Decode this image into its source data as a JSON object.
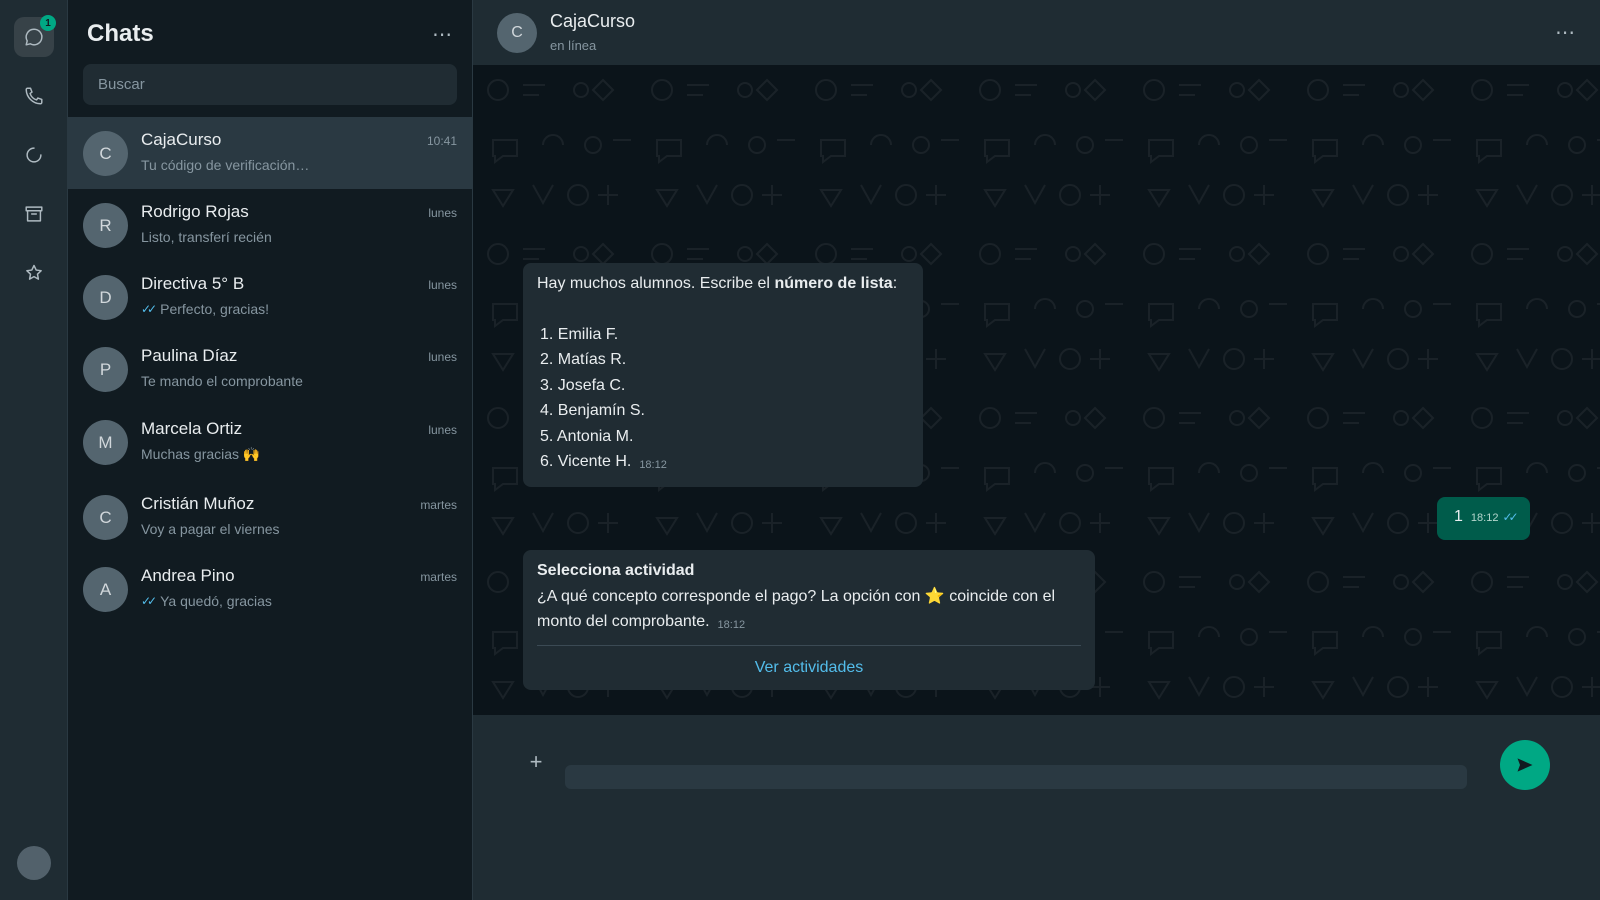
{
  "rail": {
    "badge": "1",
    "icons": [
      "chat-icon",
      "phone-icon",
      "status-icon",
      "archive-icon",
      "star-icon"
    ]
  },
  "sidebar": {
    "title": "Chats",
    "menu": "⋯",
    "search_placeholder": "Buscar",
    "chats": [
      {
        "initial": "C",
        "name": "CajaCurso",
        "time": "10:41",
        "preview": "Tu código de verificación…",
        "ticks": false,
        "selected": true
      },
      {
        "initial": "R",
        "name": "Rodrigo Rojas",
        "time": "lunes",
        "preview": "Listo, transferí recién",
        "ticks": false
      },
      {
        "initial": "D",
        "name": "Directiva 5° B",
        "time": "lunes",
        "preview": "Perfecto, gracias!",
        "ticks": true
      },
      {
        "initial": "P",
        "name": "Paulina Díaz",
        "time": "lunes",
        "preview": "Te mando el comprobante",
        "ticks": false
      },
      {
        "initial": "M",
        "name": "Marcela Ortiz",
        "time": "lunes",
        "preview": "Muchas gracias 🙌",
        "ticks": false
      },
      {
        "initial": "C",
        "name": "Cristián Muñoz",
        "time": "martes",
        "preview": "Voy a pagar el viernes",
        "ticks": false
      },
      {
        "initial": "A",
        "name": "Andrea Pino",
        "time": "martes",
        "preview": "Ya quedó, gracias",
        "ticks": true
      }
    ]
  },
  "conversation": {
    "initial": "C",
    "name": "CajaCurso",
    "status": "en línea",
    "menu": "⋯",
    "messages": {
      "list_message": {
        "intro_start": "Hay muchos alumnos. Escribe el ",
        "intro_bold": "número de lista",
        "intro_end": ":",
        "items": [
          "1. Emilia F.",
          "2. Matías R.",
          "3. Josefa C.",
          "4. Benjamín S.",
          "5. Antonia M.",
          "6. Vicente H."
        ],
        "time": "18:12"
      },
      "reply": {
        "text": "1",
        "time": "18:12",
        "ticks": "✓✓"
      },
      "activity": {
        "title": "Selecciona actividad",
        "body_start": "¿A qué concepto corresponde el pago? La opción con ",
        "body_star": "⭐",
        "body_end": " coincide con el monto del comprobante.",
        "time": "18:12",
        "link": "Ver actividades"
      }
    },
    "composer": {
      "plus": "+",
      "input_value": ""
    }
  },
  "colors": {
    "accent": "#00a884",
    "link": "#53bdeb",
    "outgoing": "#005c4b",
    "incoming": "#202c33"
  }
}
